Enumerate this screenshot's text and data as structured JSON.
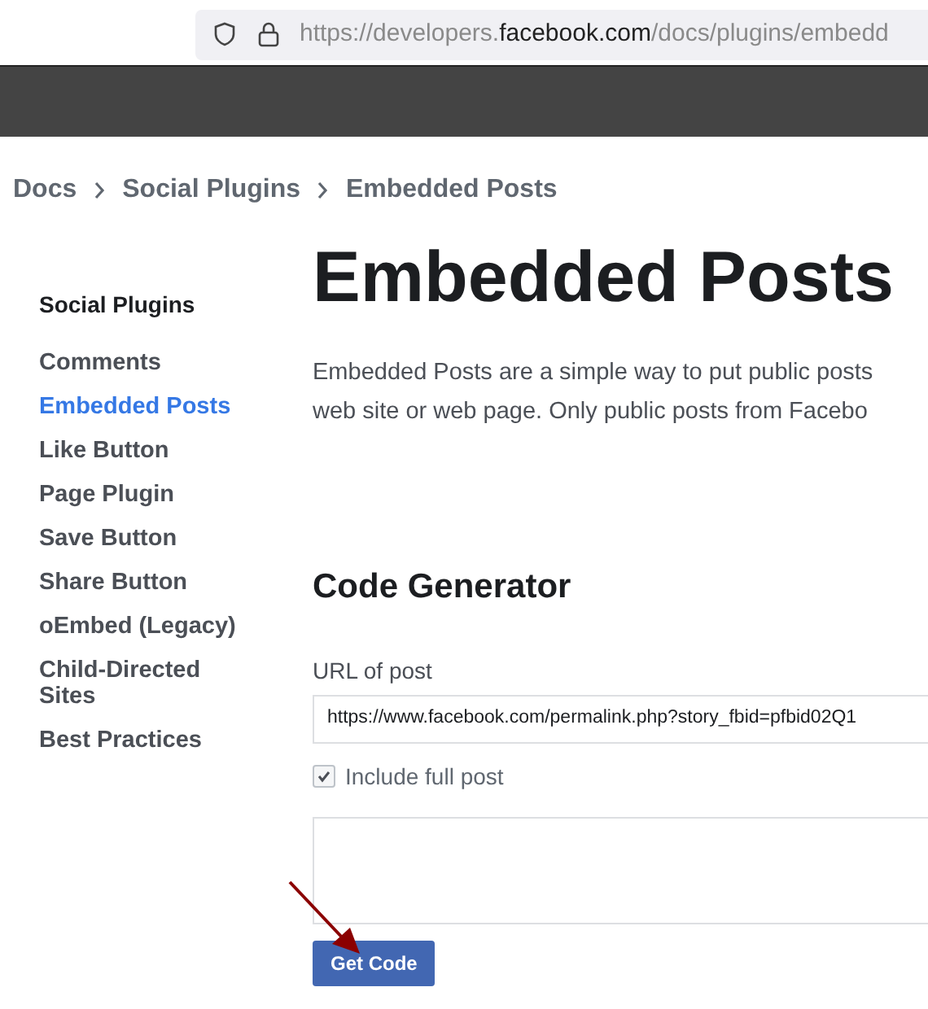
{
  "browser": {
    "url_prefix": "https://developers.",
    "url_host": "facebook.com",
    "url_suffix": "/docs/plugins/embedd"
  },
  "breadcrumb": [
    "Docs",
    "Social Plugins",
    "Embedded Posts"
  ],
  "sidebar": {
    "heading": "Social Plugins",
    "items": [
      {
        "label": "Comments",
        "selected": false
      },
      {
        "label": "Embedded Posts",
        "selected": true
      },
      {
        "label": "Like Button",
        "selected": false
      },
      {
        "label": "Page Plugin",
        "selected": false
      },
      {
        "label": "Save Button",
        "selected": false
      },
      {
        "label": "Share Button",
        "selected": false
      },
      {
        "label": "oEmbed (Legacy)",
        "selected": false
      },
      {
        "label": "Child-Directed Sites",
        "selected": false
      },
      {
        "label": "Best Practices",
        "selected": false
      }
    ]
  },
  "page": {
    "title": "Embedded Posts",
    "intro_lines": [
      "Embedded Posts are a simple way to put public posts",
      "web site or web page. Only public posts from Facebo"
    ]
  },
  "code_generator": {
    "heading": "Code Generator",
    "url_label": "URL of post",
    "url_value": "https://www.facebook.com/permalink.php?story_fbid=pfbid02Q1",
    "include_full_post": {
      "label": "Include full post",
      "checked": true
    },
    "button": "Get Code"
  }
}
